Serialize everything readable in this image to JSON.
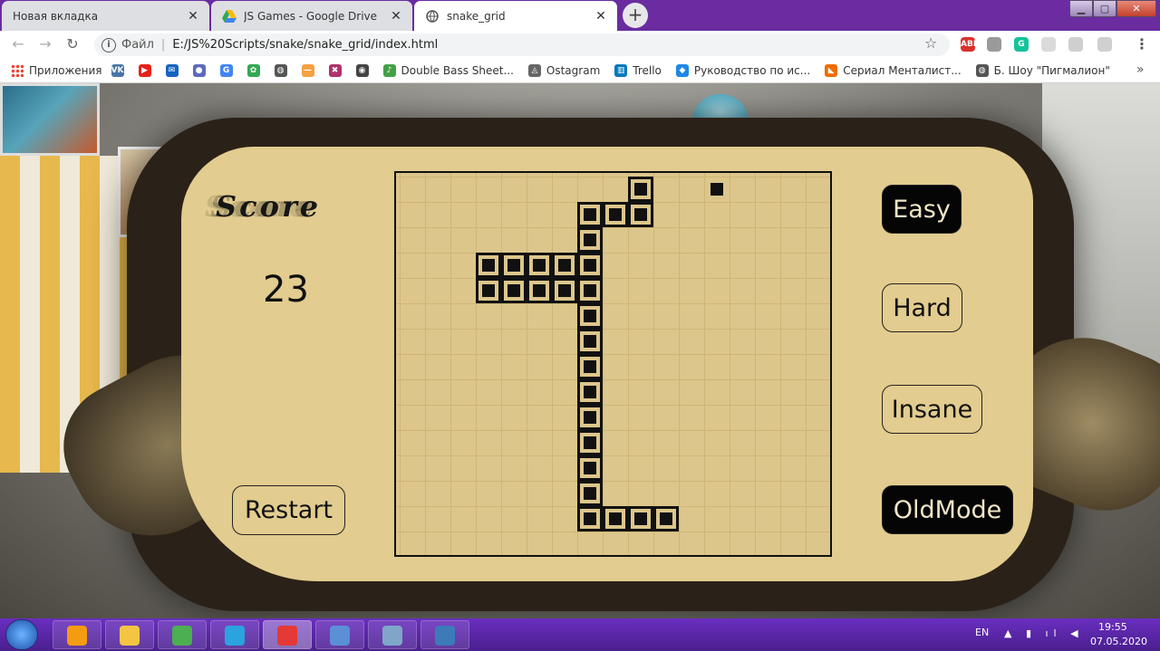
{
  "tabs": [
    {
      "title": "Новая вкладка",
      "active": false
    },
    {
      "title": "JS Games - Google Drive",
      "active": false
    },
    {
      "title": "snake_grid",
      "active": true
    }
  ],
  "tab_close_glyph": "✕",
  "newtab_glyph": "+",
  "window_controls": {
    "minimize": "▁",
    "maximize": "▢",
    "close": "✕"
  },
  "toolbar": {
    "back_glyph": "←",
    "forward_glyph": "→",
    "reload_glyph": "↻",
    "scheme_label": "Файл",
    "url": "E:/JS%20Scripts/snake/snake_grid/index.html",
    "star_glyph": "☆",
    "menu_glyph": "⋮"
  },
  "extensions": [
    {
      "name": "adblock-icon",
      "label": "ABP",
      "color": "#d8322b"
    },
    {
      "name": "pdf-icon",
      "label": "",
      "color": "#9a9a9a"
    },
    {
      "name": "grammarly-icon",
      "label": "G",
      "color": "#15c39a"
    },
    {
      "name": "extension-icon",
      "label": "",
      "color": "#dadada"
    },
    {
      "name": "translate-icon",
      "label": "",
      "color": "#cfcfcf"
    },
    {
      "name": "profile-icon",
      "label": "",
      "color": "#d0d0d0"
    }
  ],
  "bookmarks": {
    "apps_label": "Приложения",
    "items": [
      {
        "name": "vk-icon",
        "label": "",
        "color": "#4a76a8",
        "glyph": "VK"
      },
      {
        "name": "youtube-icon",
        "label": "",
        "color": "#e62117",
        "glyph": "▶"
      },
      {
        "name": "mail-icon",
        "label": "",
        "color": "#1565c0",
        "glyph": "✉"
      },
      {
        "name": "app-icon",
        "label": "",
        "color": "#5c6bc0",
        "glyph": "●"
      },
      {
        "name": "google-icon",
        "label": "",
        "color": "#4285f4",
        "glyph": "G"
      },
      {
        "name": "leaf-icon",
        "label": "",
        "color": "#34a853",
        "glyph": "✿"
      },
      {
        "name": "globe-icon",
        "label": "",
        "color": "#555555",
        "glyph": "◍"
      },
      {
        "name": "dash-icon",
        "label": "",
        "color": "#f4a142",
        "glyph": "—"
      },
      {
        "name": "pixel-icon",
        "label": "",
        "color": "#b0306c",
        "glyph": "✖"
      },
      {
        "name": "owl-icon",
        "label": "",
        "color": "#444444",
        "glyph": "◉"
      },
      {
        "name": "music-icon",
        "label": "Double Bass Sheet...",
        "color": "#43a047",
        "glyph": "♪"
      },
      {
        "name": "ostagram-icon",
        "label": "Ostagram",
        "color": "#666666",
        "glyph": "◬"
      },
      {
        "name": "trello-icon",
        "label": "Trello",
        "color": "#0079bf",
        "glyph": "▥"
      },
      {
        "name": "guide-icon",
        "label": "Руководство по ис...",
        "color": "#1e88e5",
        "glyph": "◆"
      },
      {
        "name": "fox-icon",
        "label": "Сериал Менталист...",
        "color": "#ef6c00",
        "glyph": "◣"
      },
      {
        "name": "globe2-icon",
        "label": "Б. Шоу \"Пигмалион\"",
        "color": "#555555",
        "glyph": "◍"
      }
    ],
    "more_glyph": "»"
  },
  "game": {
    "score_title": "Score",
    "score": "23",
    "buttons": {
      "restart": "Restart",
      "easy": "Easy",
      "hard": "Hard",
      "insane": "Insane",
      "oldmode": "OldMode"
    },
    "grid": {
      "cols": 17,
      "rows": 15
    },
    "snake": [
      [
        9,
        0
      ],
      [
        9,
        1
      ],
      [
        8,
        1
      ],
      [
        7,
        1
      ],
      [
        7,
        2
      ],
      [
        7,
        3
      ],
      [
        6,
        3
      ],
      [
        5,
        3
      ],
      [
        4,
        3
      ],
      [
        3,
        3
      ],
      [
        3,
        4
      ],
      [
        4,
        4
      ],
      [
        5,
        4
      ],
      [
        6,
        4
      ],
      [
        7,
        4
      ],
      [
        7,
        5
      ],
      [
        7,
        6
      ],
      [
        7,
        7
      ],
      [
        7,
        8
      ],
      [
        7,
        9
      ],
      [
        7,
        10
      ],
      [
        7,
        11
      ],
      [
        7,
        12
      ],
      [
        7,
        13
      ],
      [
        8,
        13
      ],
      [
        9,
        13
      ],
      [
        10,
        13
      ]
    ],
    "food": [
      12,
      0
    ]
  },
  "taskbar": {
    "apps": [
      {
        "name": "media-player-icon",
        "color": "#f39c12"
      },
      {
        "name": "file-explorer-icon",
        "color": "#f4c542"
      },
      {
        "name": "chrome-icon",
        "color": "#4caf50"
      },
      {
        "name": "telegram-icon",
        "color": "#2aa3df"
      },
      {
        "name": "chrome-profile-icon",
        "color": "#e53935"
      },
      {
        "name": "remote-desktop-icon",
        "color": "#5b8fd6"
      },
      {
        "name": "calculator-icon",
        "color": "#7fa6c9"
      },
      {
        "name": "photos-icon",
        "color": "#3d7ab8"
      }
    ],
    "language": "EN",
    "time": "19:55",
    "date": "07.05.2020"
  }
}
